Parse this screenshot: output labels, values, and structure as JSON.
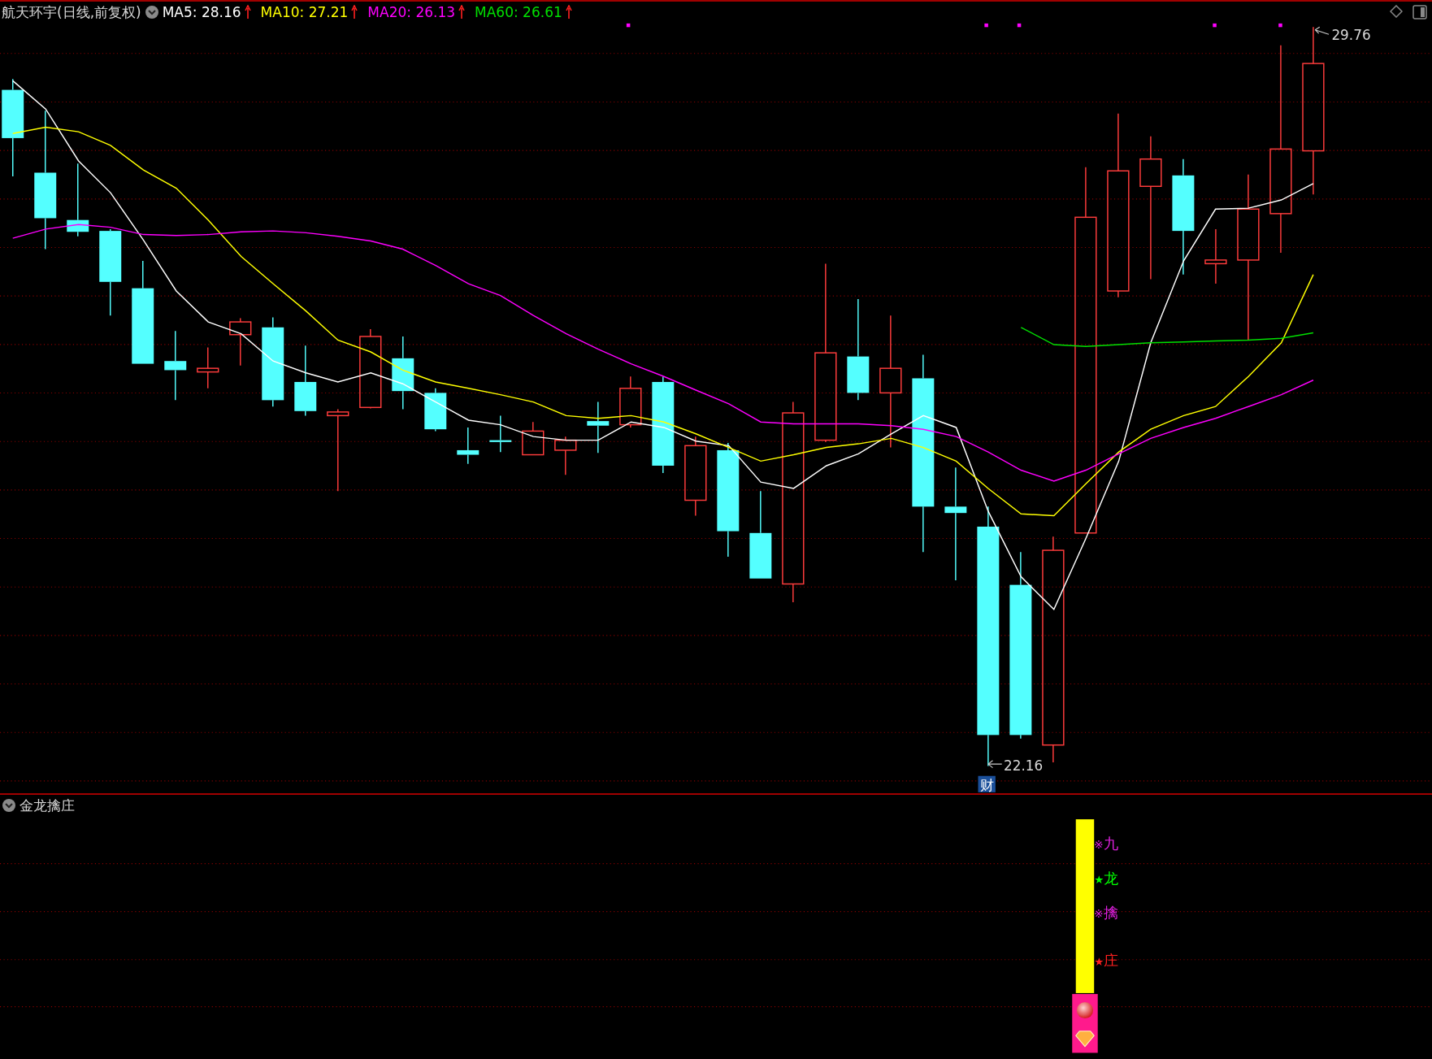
{
  "title": "航天环宇(日线,前复权)",
  "indicators": [
    {
      "label": "MA5: 28.16",
      "color": "#ffffff"
    },
    {
      "label": "MA10: 27.21",
      "color": "#ffff00"
    },
    {
      "label": "MA20: 26.13",
      "color": "#ff00ff"
    },
    {
      "label": "MA60: 26.61",
      "color": "#00e000"
    }
  ],
  "price_chart": {
    "high_label": "29.76",
    "low_label": "22.16",
    "badge": "财"
  },
  "sub_panel": {
    "title": "金龙擒庄",
    "signals": [
      {
        "symbol": "※",
        "label": "九",
        "color": "#e020e0"
      },
      {
        "symbol": "★",
        "label": "龙",
        "color": "#00ff00"
      },
      {
        "symbol": "※",
        "label": "擒",
        "color": "#e020e0"
      },
      {
        "symbol": "★",
        "label": "庄",
        "color": "#ff2020"
      }
    ]
  }
}
